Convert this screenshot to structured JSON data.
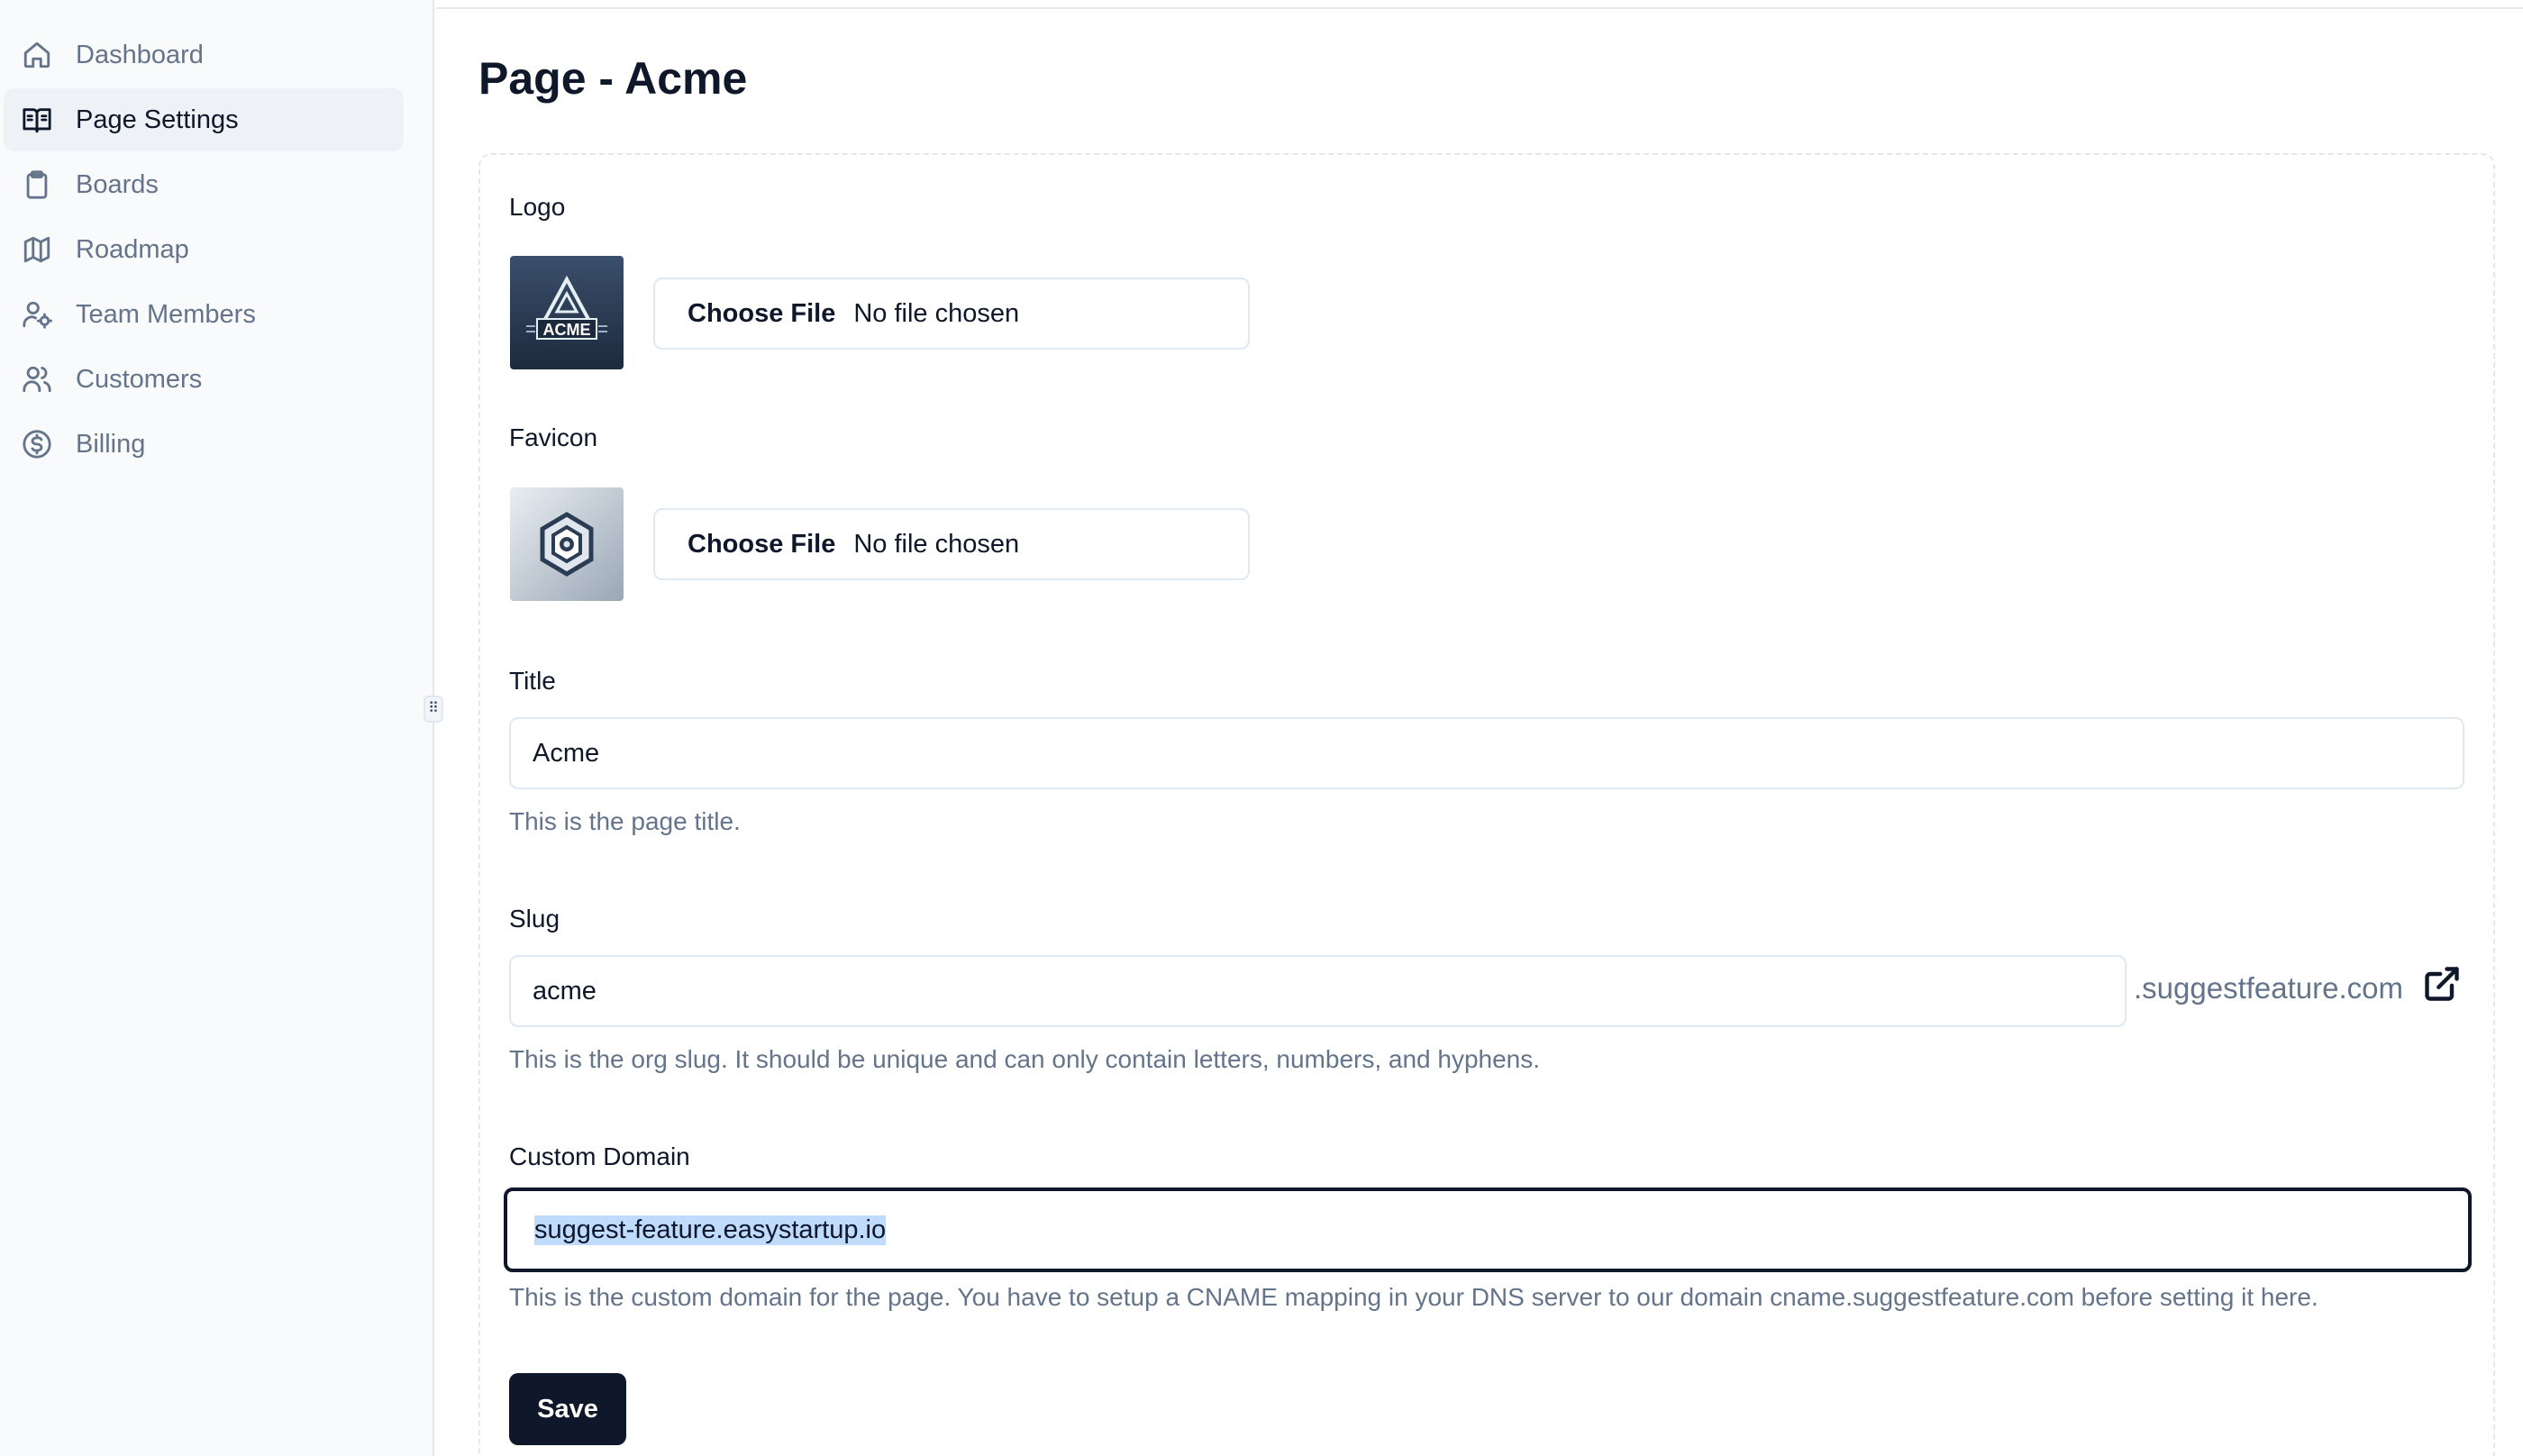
{
  "sidebar": {
    "items": [
      {
        "label": "Dashboard",
        "icon": "home-icon",
        "active": false
      },
      {
        "label": "Page Settings",
        "icon": "book-open-icon",
        "active": true
      },
      {
        "label": "Boards",
        "icon": "clipboard-icon",
        "active": false
      },
      {
        "label": "Roadmap",
        "icon": "map-icon",
        "active": false
      },
      {
        "label": "Team Members",
        "icon": "user-cog-icon",
        "active": false
      },
      {
        "label": "Customers",
        "icon": "users-icon",
        "active": false
      },
      {
        "label": "Billing",
        "icon": "dollar-circle-icon",
        "active": false
      }
    ],
    "resize_handle": "⠿"
  },
  "page": {
    "title": "Page - Acme"
  },
  "form": {
    "logo": {
      "label": "Logo",
      "file_button": "Choose File",
      "file_status": "No file chosen",
      "image_text": "ACME"
    },
    "favicon": {
      "label": "Favicon",
      "file_button": "Choose File",
      "file_status": "No file chosen"
    },
    "title": {
      "label": "Title",
      "value": "Acme",
      "help": "This is the page title."
    },
    "slug": {
      "label": "Slug",
      "value": "acme",
      "suffix": ".suggestfeature.com",
      "help": "This is the org slug. It should be unique and can only contain letters, numbers, and hyphens."
    },
    "custom_domain": {
      "label": "Custom Domain",
      "value": "suggest-feature.easystartup.io",
      "help": "This is the custom domain for the page. You have to setup a CNAME mapping in your DNS server to our domain cname.suggestfeature.com before setting it here."
    },
    "save_label": "Save"
  },
  "colors": {
    "primary": "#0f172a",
    "muted_text": "#64748b",
    "border": "#e2e8f0",
    "sidebar_bg": "#f8fafc",
    "active_item_bg": "#eef2f6",
    "selection": "#bfdbfe"
  }
}
